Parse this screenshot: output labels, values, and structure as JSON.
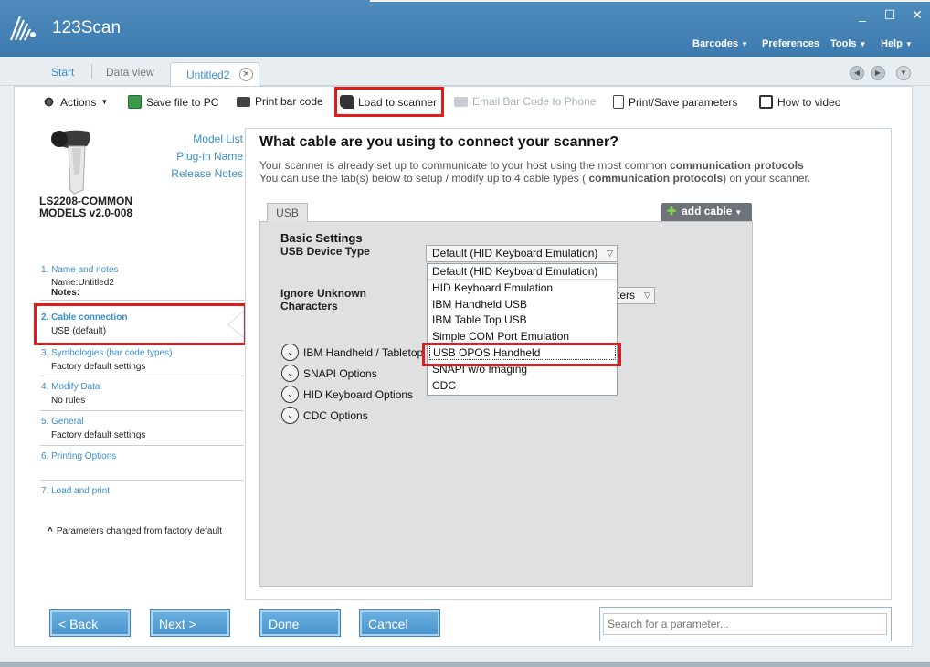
{
  "app": {
    "title": "123Scan",
    "window_controls": [
      "_",
      "☐",
      "✕"
    ]
  },
  "menu": [
    "Barcodes",
    "Preferences",
    "Tools",
    "Help"
  ],
  "tabs": {
    "start": "Start",
    "data_view": "Data view",
    "active": "Untitled2"
  },
  "toolbar": {
    "actions": "Actions",
    "save_file": "Save file to PC",
    "print_bar_code": "Print bar code",
    "load_to_scanner": "Load to scanner",
    "email": "Email Bar Code to Phone",
    "print_save_params": "Print/Save parameters",
    "how_to_video": "How to video"
  },
  "model": {
    "name_line1": "LS2208-COMMON",
    "name_line2": "MODELS v2.0-008",
    "links": [
      "Model List",
      "Plug-in Name",
      "Release Notes"
    ]
  },
  "steps": [
    {
      "num": "1.  Name and notes",
      "sub1": "Name:Untitled2",
      "sub2": "Notes:"
    },
    {
      "num": "2.  Cable connection",
      "sub": "USB (default)"
    },
    {
      "num": "3.  Symbologies (bar code types)",
      "sub": "Factory default settings"
    },
    {
      "num": "4.  Modify Data",
      "sub": "No rules"
    },
    {
      "num": "5.  General",
      "sub": "Factory default settings"
    },
    {
      "num": "6.  Printing Options",
      "sub": ""
    },
    {
      "num": "7.  Load and print",
      "sub": ""
    }
  ],
  "footnote": "Parameters changed from factory default",
  "footnote_mark": "^",
  "content": {
    "title": "What cable are you using to connect your scanner?",
    "desc_line1_a": "Your scanner is already set up to communicate to your host using the most common ",
    "desc_line1_b": "communication protocols",
    "desc_line2_a": "You can use the tab(s) below to setup / modify up to 4 cable types ( ",
    "desc_line2_b": "communication protocols",
    "desc_line2_c": ") on your scanner.",
    "cable_tab": "USB",
    "add_cable": "add cable",
    "basic_settings": "Basic Settings",
    "usb_device_type_label": "USB Device Type",
    "usb_device_type_value": "Default (HID Keyboard Emulation)",
    "ignore_unknown_line1": "Ignore Unknown",
    "ignore_unknown_line2": "Characters",
    "ignore_unknown_value_fragment": "ters",
    "dropdown_options": [
      "Default (HID Keyboard Emulation)",
      "HID Keyboard Emulation",
      "IBM Handheld USB",
      "IBM Table Top USB",
      "Simple COM Port Emulation",
      "USB OPOS Handheld",
      "SNAPI w/o Imaging",
      "CDC"
    ],
    "sections": [
      "IBM Handheld / Tabletop",
      "SNAPI Options",
      "HID Keyboard Options",
      "CDC Options"
    ]
  },
  "buttons": {
    "back": "< Back",
    "next": "Next >",
    "done": "Done",
    "cancel": "Cancel"
  },
  "search": {
    "placeholder": "Search for a parameter..."
  }
}
